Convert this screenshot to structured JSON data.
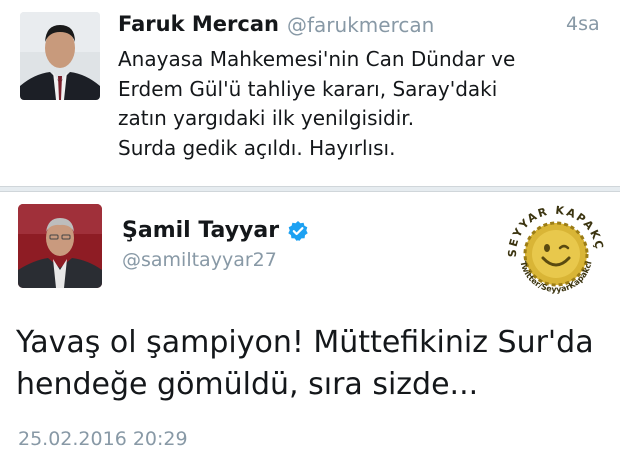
{
  "tweet1": {
    "name": "Faruk Mercan",
    "handle": "@farukmercan",
    "time": "4sa",
    "text_lines": [
      "Anayasa Mahkemesi'nin Can Dündar ve",
      "Erdem Gül'ü tahliye kararı, Saray'daki",
      "zatın yargıdaki ilk yenilgisidir.",
      "Surda gedik açıldı. Hayırlısı."
    ]
  },
  "tweet2": {
    "name": "Şamil Tayyar",
    "handle": "@samiltayyar27",
    "verified_icon": "verified-badge-icon",
    "text_lines": [
      "Yavaş ol şampiyon! Müttefikiniz Sur'da",
      "hendeğe gömüldü, sıra sizde..."
    ],
    "date": "25.02.2016 20:29"
  },
  "watermark": {
    "top_text": "SEYYAR KAPAKÇI",
    "bottom_text": "Twitter/SeyyarKapakci"
  },
  "colors": {
    "text": "#14171a",
    "muted": "#8899a6",
    "verified": "#1da1f2",
    "cap": "#d9b536"
  }
}
